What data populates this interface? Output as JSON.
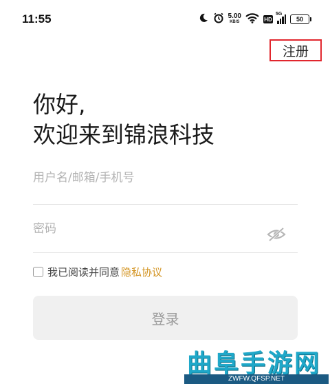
{
  "status_bar": {
    "time": "11:55",
    "icons": [
      "moon-icon",
      "alarm-icon",
      "wifi-icon",
      "hd-icon",
      "signal-icon",
      "battery-icon"
    ],
    "net_speed_value": "5.00",
    "net_speed_unit": "KB/S",
    "hd_label": "HD",
    "network_type": "5G",
    "battery_level": "50"
  },
  "header": {
    "register_label": "注册"
  },
  "greeting": {
    "line1": "你好,",
    "line2": "欢迎来到锦浪科技"
  },
  "form": {
    "username_placeholder": "用户名/邮箱/手机号",
    "password_placeholder": "密码",
    "agree_text": "我已阅读并同意",
    "privacy_link": "隐私协议",
    "login_label": "登录"
  },
  "watermark": {
    "title": "曲阜手游网",
    "url": "ZWFW.QFSP.NET"
  },
  "colors": {
    "accent_link": "#d39422",
    "highlight_border": "#e1262d",
    "button_bg": "#f0f0f0"
  }
}
